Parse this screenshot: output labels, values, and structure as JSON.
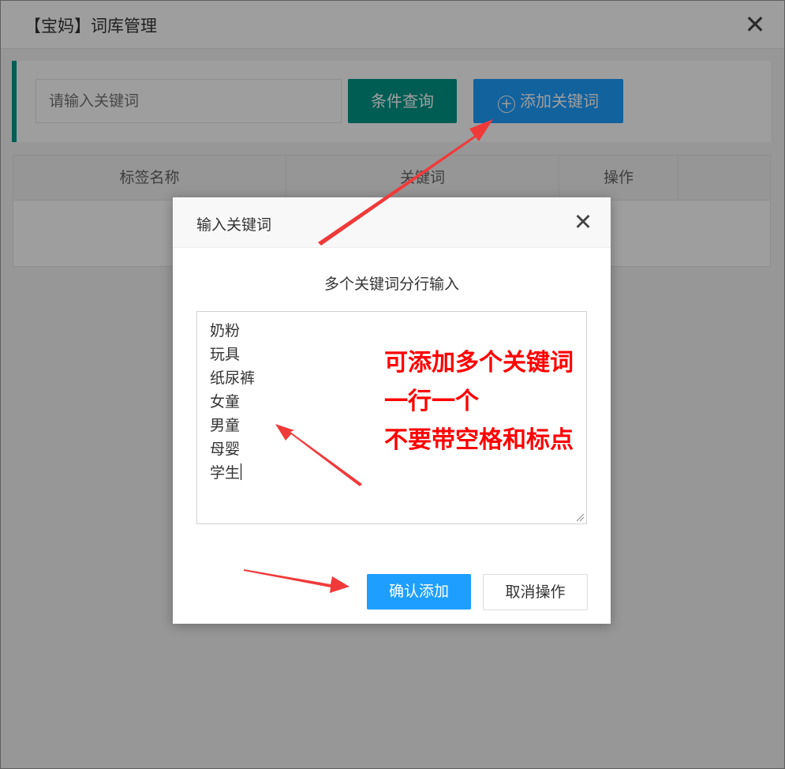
{
  "window": {
    "title": "【宝妈】词库管理",
    "close_glyph": "✕"
  },
  "search": {
    "placeholder": "请输入关键词",
    "query_label": "条件查询",
    "add_label": "添加关键词",
    "add_icon": "plus-circle-icon"
  },
  "table": {
    "columns": [
      "标签名称",
      "关键词",
      "操作"
    ]
  },
  "dialog": {
    "title": "输入关键词",
    "close_glyph": "✕",
    "hint": "多个关键词分行输入",
    "keywords": [
      "奶粉",
      "玩具",
      "纸尿裤",
      "女童",
      "男童",
      "母婴",
      "学生"
    ],
    "confirm_label": "确认添加",
    "cancel_label": "取消操作"
  },
  "annotation": {
    "lines": [
      "可添加多个关键词",
      "一行一个",
      "不要带空格和标点"
    ],
    "color": "#ff0000"
  },
  "colors": {
    "primary_green": "#009688",
    "primary_blue": "#1E9FFF",
    "arrow_red": "#f03a3a"
  }
}
